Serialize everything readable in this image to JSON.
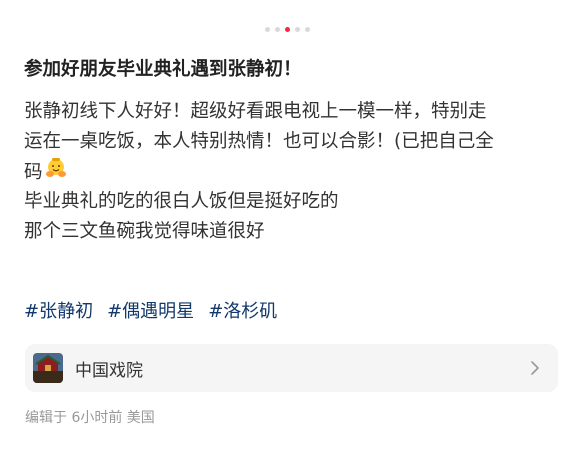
{
  "carousel": {
    "total_dots": 5,
    "active_index": 2
  },
  "post": {
    "title": "参加好朋友毕业典礼遇到张静初！",
    "body_lines": [
      "张静初线下人好好！超级好看跟电视上一模一样，特别走",
      "运在一桌吃饭，本人特别热情！也可以合影！(已把自己全",
      "码",
      "毕业典礼的吃的很白人饭但是挺好吃的",
      "那个三文鱼碗我觉得味道很好"
    ],
    "emoji_icon": "hugging-face-emoji-icon",
    "tags": [
      "#张静初",
      "#偶遇明星",
      "#洛杉矶"
    ]
  },
  "location": {
    "name": "中国戏院",
    "icon": "theater-thumbnail",
    "chevron": "chevron-right-icon"
  },
  "meta": {
    "text": "编辑于 6小时前 美国"
  },
  "colors": {
    "accent": "#ff2442",
    "tag": "#13386c",
    "meta": "#999999",
    "card_bg": "#f5f5f5"
  }
}
